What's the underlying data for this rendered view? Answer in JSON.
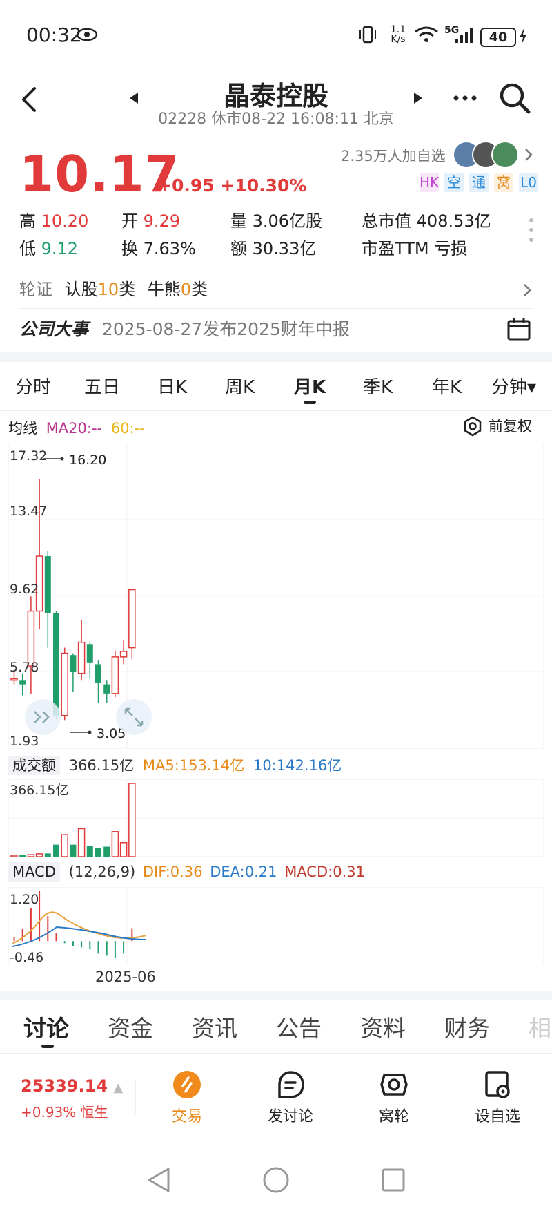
{
  "status": {
    "time": "00:32",
    "net": "1.1 K/s",
    "signal": "5G",
    "battery": "40"
  },
  "header": {
    "title": "晶泰控股",
    "code": "02228",
    "status_text": "休市08-22 16:08:11 北京"
  },
  "quote": {
    "price": "10.17",
    "change": "+0.95",
    "change_pct": "+10.30%",
    "followers": "2.35万人加自选",
    "tags": [
      "HK",
      "空",
      "通",
      "窝",
      "L0"
    ],
    "stats": [
      {
        "label": "高",
        "value": "10.20",
        "color": "red"
      },
      {
        "label": "开",
        "value": "9.29",
        "color": "red"
      },
      {
        "label": "量",
        "value": "3.06亿股",
        "color": "plain"
      },
      {
        "label": "总市值",
        "value": "408.53亿",
        "color": "plain"
      },
      {
        "label": "低",
        "value": "9.12",
        "color": "green"
      },
      {
        "label": "换",
        "value": "7.63%",
        "color": "plain"
      },
      {
        "label": "额",
        "value": "30.33亿",
        "color": "plain"
      },
      {
        "label": "市盈TTM",
        "value": "亏损",
        "color": "plain"
      }
    ]
  },
  "warrants": {
    "label": "轮证",
    "rengu": "认股",
    "rengu_count": "10",
    "rengu_unit": "类",
    "niuxiong": "牛熊",
    "niuxiong_count": "0",
    "niuxiong_unit": "类"
  },
  "event": {
    "title": "公司大事",
    "text": "2025-08-27发布2025财年中报"
  },
  "period_tabs": [
    "分时",
    "五日",
    "日K",
    "周K",
    "月K",
    "季K",
    "年K",
    "分钟▾"
  ],
  "active_period": "月K",
  "ma_bar": {
    "label": "均线",
    "ma20": "MA20:--",
    "ma60": "60:--",
    "adjust": "前复权"
  },
  "kline_labels": {
    "y1": "17.32",
    "y2": "13.47",
    "y3": "9.62",
    "y4": "5.78",
    "y5": "1.93",
    "high": "16.20",
    "low": "3.05"
  },
  "chart_data": [
    {
      "type": "candlestick",
      "title": "月K",
      "ylim": [
        1.93,
        17.32
      ],
      "ticks": [
        17.32,
        13.47,
        9.62,
        5.78,
        1.93
      ],
      "candles": [
        {
          "open": 5.3,
          "close": 5.3,
          "high": 5.8,
          "low": 5.0
        },
        {
          "open": 5.2,
          "close": 5.0,
          "high": 5.6,
          "low": 4.4
        },
        {
          "open": 6.0,
          "close": 9.0,
          "high": 9.8,
          "low": 4.5
        },
        {
          "open": 9.0,
          "close": 12.0,
          "high": 16.2,
          "low": 8.0
        },
        {
          "open": 12.0,
          "close": 8.9,
          "high": 12.3,
          "low": 7.0
        },
        {
          "open": 8.9,
          "close": 3.3,
          "high": 9.0,
          "low": 3.1
        },
        {
          "open": 3.3,
          "close": 6.7,
          "high": 7.0,
          "low": 3.05
        },
        {
          "open": 6.6,
          "close": 5.7,
          "high": 6.7,
          "low": 4.6
        },
        {
          "open": 5.6,
          "close": 7.3,
          "high": 8.5,
          "low": 5.2
        },
        {
          "open": 7.2,
          "close": 6.2,
          "high": 7.3,
          "low": 5.3
        },
        {
          "open": 6.1,
          "close": 5.1,
          "high": 6.3,
          "low": 4.0
        },
        {
          "open": 5.0,
          "close": 4.5,
          "high": 5.2,
          "low": 4.0
        },
        {
          "open": 4.5,
          "close": 6.5,
          "high": 6.8,
          "low": 4.3
        },
        {
          "open": 6.5,
          "close": 6.8,
          "high": 7.4,
          "low": 6.1
        },
        {
          "open": 7.0,
          "close": 10.17,
          "high": 10.2,
          "low": 6.4
        }
      ]
    },
    {
      "type": "bar",
      "title": "成交额",
      "values": [
        4,
        6,
        10,
        14,
        16,
        60,
        110,
        60,
        140,
        55,
        45,
        50,
        125,
        70,
        366.15
      ],
      "ma5": "MA5:153.14亿",
      "ma10": "10:142.16亿",
      "current": "366.15亿",
      "ylim": [
        0,
        366.15
      ]
    },
    {
      "type": "bar",
      "title": "MACD",
      "params": "(12,26,9)",
      "dif": "DIF:0.36",
      "dea": "DEA:0.21",
      "macd": "MACD:0.31",
      "ylim": [
        -0.46,
        1.2
      ],
      "values": [
        0.1,
        0.3,
        0.8,
        1.2,
        0.6,
        0.2,
        -0.05,
        -0.12,
        -0.15,
        -0.2,
        -0.3,
        -0.35,
        -0.4,
        -0.3,
        0.31
      ],
      "xlabel": "2025-06"
    }
  ],
  "chart_text": {
    "vol_label": "成交额",
    "vol_current": "366.15亿",
    "vol_axis": "366.15亿",
    "macd_label": "MACD",
    "macd_params": "(12,26,9)",
    "macd_top": "1.20",
    "macd_bottom": "-0.46",
    "xlabel": "2025-06"
  },
  "bottom_tabs": [
    "讨论",
    "资金",
    "资讯",
    "公告",
    "资料",
    "财务",
    "相"
  ],
  "active_bottom_tab": "讨论",
  "index": {
    "value": "25339.14",
    "change": "+0.93%",
    "name": "恒生"
  },
  "nav": [
    {
      "label": "交易",
      "icon": "trade-icon",
      "active": true
    },
    {
      "label": "发讨论",
      "icon": "chat-icon",
      "active": false
    },
    {
      "label": "窝轮",
      "icon": "warrant-icon",
      "active": false
    },
    {
      "label": "设自选",
      "icon": "add-watch-icon",
      "active": false
    }
  ]
}
